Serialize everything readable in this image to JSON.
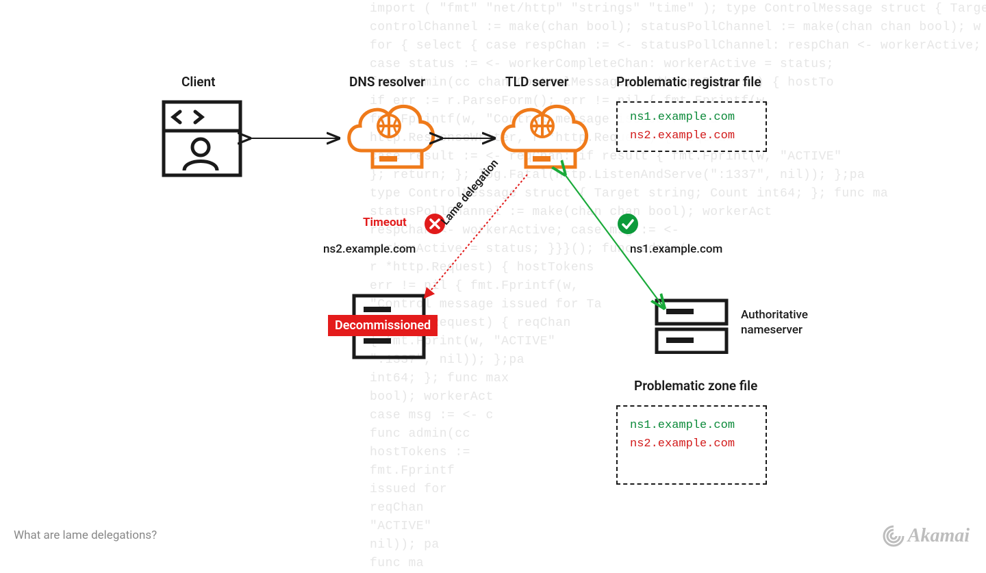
{
  "title_footer": "What are lame delegations?",
  "brand": "Akamai",
  "labels": {
    "client": "Client",
    "resolver": "DNS resolver",
    "tld": "TLD server",
    "registrar_title": "Problematic registrar file",
    "zone_title": "Problematic zone file",
    "timeout": "Timeout",
    "ns2": "ns2.example.com",
    "ns1": "ns1.example.com",
    "decommissioned": "Decommissioned",
    "lame": "Lame delegation",
    "auth_ns_line1": "Authoritative",
    "auth_ns_line2": "nameserver"
  },
  "registrar_file": {
    "line1": "ns1.example.com",
    "line2": "ns2.example.com"
  },
  "zone_file": {
    "line1": "ns1.example.com",
    "line2": "ns2.example.com"
  },
  "bg_code": "import ( \"fmt\" \"net/http\" \"strings\" \"time\" ); type ControlMessage struct { Target string; Cou\ncontrolChannel := make(chan bool); statusPollChannel := make(chan chan bool); w\nfor { select { case respChan := <- statusPollChannel: respChan <- workerActive; case\ncase status := <- workerCompleteChan: workerActive = status;\nfunc admin(cc chan ControlMessage, r *http.Request) { hostTo\nif err := r.ParseForm(); err != nil { fmt.Fprintf(w,\nfmt.Fprintf(w, \"Control message issued for Ta\nhttp.ResponseWriter, r *http.Request) { reqChan\ncase result := <- reqChan: if result { fmt.Fprint(w, \"ACTIVE\"\n}; return; }; log.Fatal(http.ListenAndServe(\":1337\", nil)); };pa\ntype ControlMessage struct { Target string; Count int64; }; func ma\nstatusPollChannel := make(chan chan bool); workerAct\nrespChan <- workerActive; case msg := <-\nworkerActive = status; }}}(); func admin(c\nr *http.Request) { hostTokens\nerr != nil { fmt.Fprintf(w,\n\"Control message issued for Ta\nr *http.Request) { reqChan\n{ fmt.Fprint(w, \"ACTIVE\"\n\":1337\", nil)); };pa\nint64; }; func max\nbool); workerAct\ncase msg := <- c\nfunc admin(cc\nhostTokens :=\nfmt.Fprintf\nissued for\nreqChan\n\"ACTIVE\"\nnil)); pa\nfunc ma"
}
